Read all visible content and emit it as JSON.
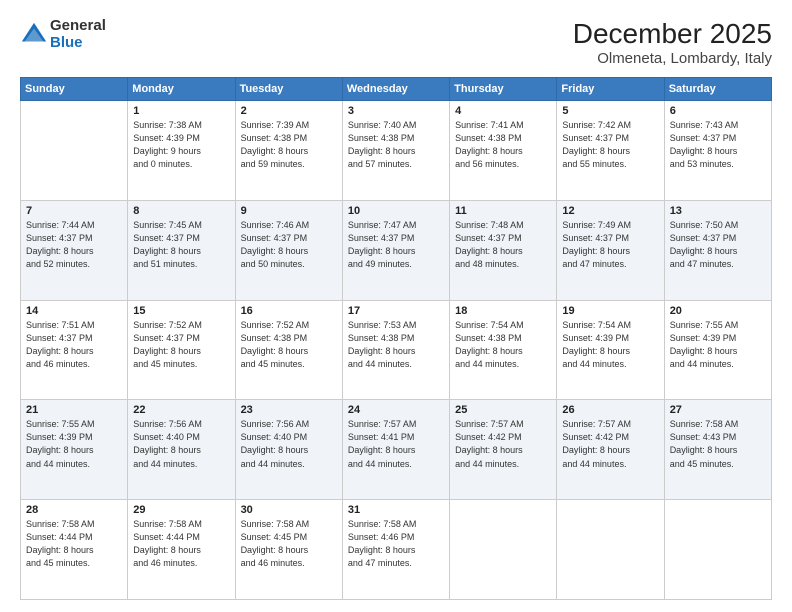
{
  "header": {
    "logo_general": "General",
    "logo_blue": "Blue",
    "month_title": "December 2025",
    "location": "Olmeneta, Lombardy, Italy"
  },
  "weekdays": [
    "Sunday",
    "Monday",
    "Tuesday",
    "Wednesday",
    "Thursday",
    "Friday",
    "Saturday"
  ],
  "weeks": [
    [
      {
        "day": "",
        "info": ""
      },
      {
        "day": "1",
        "info": "Sunrise: 7:38 AM\nSunset: 4:39 PM\nDaylight: 9 hours\nand 0 minutes."
      },
      {
        "day": "2",
        "info": "Sunrise: 7:39 AM\nSunset: 4:38 PM\nDaylight: 8 hours\nand 59 minutes."
      },
      {
        "day": "3",
        "info": "Sunrise: 7:40 AM\nSunset: 4:38 PM\nDaylight: 8 hours\nand 57 minutes."
      },
      {
        "day": "4",
        "info": "Sunrise: 7:41 AM\nSunset: 4:38 PM\nDaylight: 8 hours\nand 56 minutes."
      },
      {
        "day": "5",
        "info": "Sunrise: 7:42 AM\nSunset: 4:37 PM\nDaylight: 8 hours\nand 55 minutes."
      },
      {
        "day": "6",
        "info": "Sunrise: 7:43 AM\nSunset: 4:37 PM\nDaylight: 8 hours\nand 53 minutes."
      }
    ],
    [
      {
        "day": "7",
        "info": "Sunrise: 7:44 AM\nSunset: 4:37 PM\nDaylight: 8 hours\nand 52 minutes."
      },
      {
        "day": "8",
        "info": "Sunrise: 7:45 AM\nSunset: 4:37 PM\nDaylight: 8 hours\nand 51 minutes."
      },
      {
        "day": "9",
        "info": "Sunrise: 7:46 AM\nSunset: 4:37 PM\nDaylight: 8 hours\nand 50 minutes."
      },
      {
        "day": "10",
        "info": "Sunrise: 7:47 AM\nSunset: 4:37 PM\nDaylight: 8 hours\nand 49 minutes."
      },
      {
        "day": "11",
        "info": "Sunrise: 7:48 AM\nSunset: 4:37 PM\nDaylight: 8 hours\nand 48 minutes."
      },
      {
        "day": "12",
        "info": "Sunrise: 7:49 AM\nSunset: 4:37 PM\nDaylight: 8 hours\nand 47 minutes."
      },
      {
        "day": "13",
        "info": "Sunrise: 7:50 AM\nSunset: 4:37 PM\nDaylight: 8 hours\nand 47 minutes."
      }
    ],
    [
      {
        "day": "14",
        "info": "Sunrise: 7:51 AM\nSunset: 4:37 PM\nDaylight: 8 hours\nand 46 minutes."
      },
      {
        "day": "15",
        "info": "Sunrise: 7:52 AM\nSunset: 4:37 PM\nDaylight: 8 hours\nand 45 minutes."
      },
      {
        "day": "16",
        "info": "Sunrise: 7:52 AM\nSunset: 4:38 PM\nDaylight: 8 hours\nand 45 minutes."
      },
      {
        "day": "17",
        "info": "Sunrise: 7:53 AM\nSunset: 4:38 PM\nDaylight: 8 hours\nand 44 minutes."
      },
      {
        "day": "18",
        "info": "Sunrise: 7:54 AM\nSunset: 4:38 PM\nDaylight: 8 hours\nand 44 minutes."
      },
      {
        "day": "19",
        "info": "Sunrise: 7:54 AM\nSunset: 4:39 PM\nDaylight: 8 hours\nand 44 minutes."
      },
      {
        "day": "20",
        "info": "Sunrise: 7:55 AM\nSunset: 4:39 PM\nDaylight: 8 hours\nand 44 minutes."
      }
    ],
    [
      {
        "day": "21",
        "info": "Sunrise: 7:55 AM\nSunset: 4:39 PM\nDaylight: 8 hours\nand 44 minutes."
      },
      {
        "day": "22",
        "info": "Sunrise: 7:56 AM\nSunset: 4:40 PM\nDaylight: 8 hours\nand 44 minutes."
      },
      {
        "day": "23",
        "info": "Sunrise: 7:56 AM\nSunset: 4:40 PM\nDaylight: 8 hours\nand 44 minutes."
      },
      {
        "day": "24",
        "info": "Sunrise: 7:57 AM\nSunset: 4:41 PM\nDaylight: 8 hours\nand 44 minutes."
      },
      {
        "day": "25",
        "info": "Sunrise: 7:57 AM\nSunset: 4:42 PM\nDaylight: 8 hours\nand 44 minutes."
      },
      {
        "day": "26",
        "info": "Sunrise: 7:57 AM\nSunset: 4:42 PM\nDaylight: 8 hours\nand 44 minutes."
      },
      {
        "day": "27",
        "info": "Sunrise: 7:58 AM\nSunset: 4:43 PM\nDaylight: 8 hours\nand 45 minutes."
      }
    ],
    [
      {
        "day": "28",
        "info": "Sunrise: 7:58 AM\nSunset: 4:44 PM\nDaylight: 8 hours\nand 45 minutes."
      },
      {
        "day": "29",
        "info": "Sunrise: 7:58 AM\nSunset: 4:44 PM\nDaylight: 8 hours\nand 46 minutes."
      },
      {
        "day": "30",
        "info": "Sunrise: 7:58 AM\nSunset: 4:45 PM\nDaylight: 8 hours\nand 46 minutes."
      },
      {
        "day": "31",
        "info": "Sunrise: 7:58 AM\nSunset: 4:46 PM\nDaylight: 8 hours\nand 47 minutes."
      },
      {
        "day": "",
        "info": ""
      },
      {
        "day": "",
        "info": ""
      },
      {
        "day": "",
        "info": ""
      }
    ]
  ]
}
